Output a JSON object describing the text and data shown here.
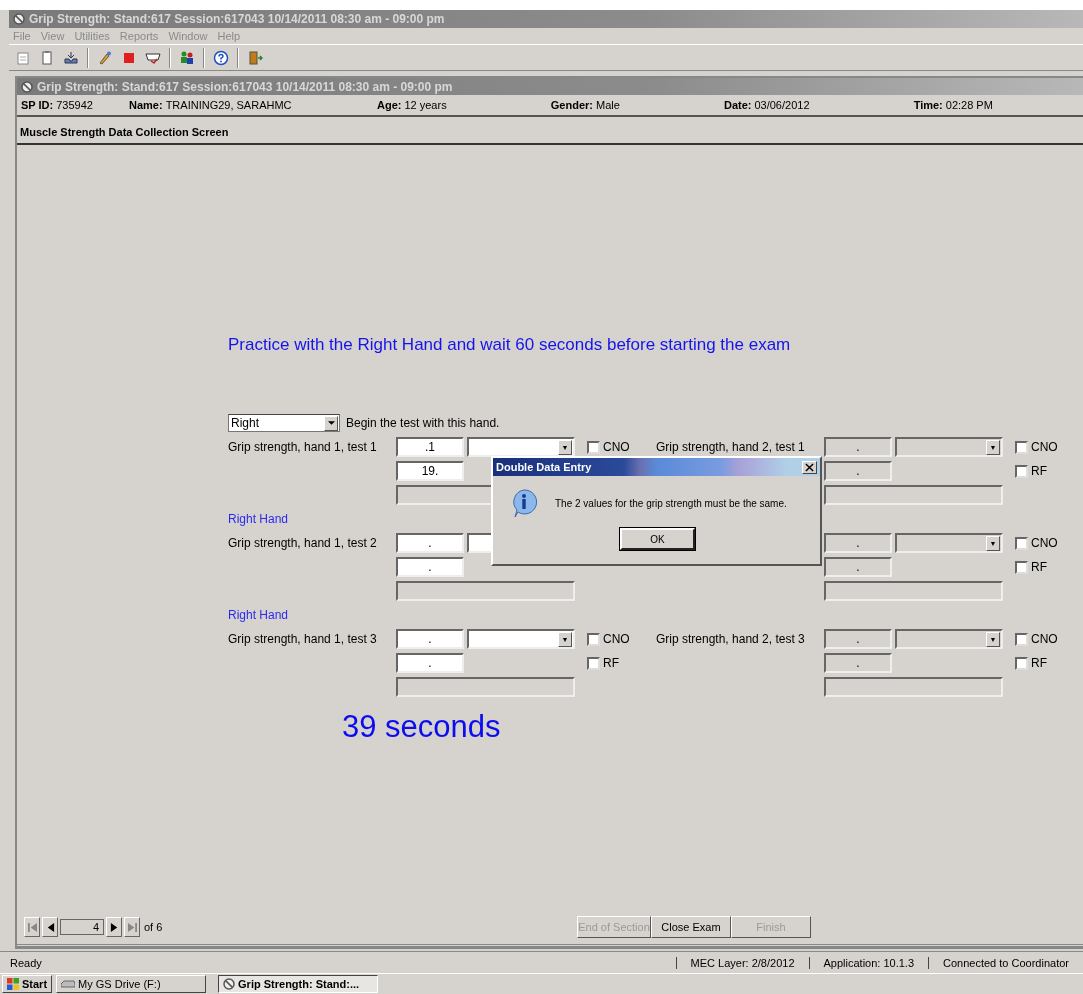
{
  "window": {
    "title": "Grip Strength: Stand:617 Session:617043 10/14/2011 08:30 am - 09:00 pm"
  },
  "menu": [
    {
      "label": "File",
      "disabled": true
    },
    {
      "label": "View",
      "disabled": true
    },
    {
      "label": "Utilities",
      "disabled": true
    },
    {
      "label": "Reports",
      "disabled": true
    },
    {
      "label": "Window",
      "disabled": true
    },
    {
      "label": "Help",
      "disabled": true
    }
  ],
  "inner_window": {
    "title": "Grip Strength: Stand:617 Session:617043 10/14/2011 08:30 am - 09:00 pm"
  },
  "participant": [
    {
      "label": "SP ID:",
      "value": "735942"
    },
    {
      "label": "Name:",
      "value": "TRAINING29, SARAHMC"
    },
    {
      "label": "Age:",
      "value": "12 years"
    },
    {
      "label": "Gender:",
      "value": "Male"
    },
    {
      "label": "Date:",
      "value": "03/06/2012"
    },
    {
      "label": "Time:",
      "value": "02:28 PM"
    }
  ],
  "section_title": "Muscle Strength Data Collection Screen",
  "instruction": "Practice with the Right Hand and wait 60 seconds before starting the exam",
  "hand_select": {
    "value": "Right",
    "label": "Begin the test with this hand."
  },
  "tests": [
    {
      "hand_1": {
        "label": "Grip strength, hand 1, test 1",
        "disabled": false,
        "value_1": ".1",
        "value_2": "19.",
        "dropdown_arrow": "▼",
        "cno": {
          "label": "CNO",
          "checked": false
        }
      },
      "hand_2": {
        "label": "Grip strength, hand 2, test 1",
        "disabled": true,
        "value_1": ".",
        "value_2": ".",
        "dropdown_arrow": "▼",
        "cno": {
          "label": "CNO",
          "checked": false
        },
        "rf": {
          "label": "RF",
          "checked": false
        }
      }
    },
    {
      "caption": "Right Hand",
      "hand_1": {
        "label": "Grip strength, hand 1, test 2",
        "disabled": false,
        "value_1": ".",
        "value_2": "."
      },
      "hand_2": {
        "disabled": true,
        "value_1": ".",
        "value_2": ".",
        "dropdown_arrow": "▼",
        "cno": {
          "label": "CNO",
          "checked": false
        },
        "rf": {
          "label": "RF",
          "checked": false
        }
      }
    },
    {
      "caption": "Right Hand",
      "hand_1": {
        "label": "Grip strength, hand 1, test 3",
        "disabled": false,
        "value_1": ".",
        "value_2": ".",
        "dropdown_arrow": "▼",
        "cno": {
          "label": "CNO",
          "checked": false
        },
        "rf": {
          "label": "RF",
          "checked": false
        }
      },
      "hand_2": {
        "label": "Grip strength, hand 2, test 3",
        "disabled": true,
        "value_1": ".",
        "value_2": ".",
        "dropdown_arrow": "▼",
        "cno": {
          "label": "CNO",
          "checked": false
        },
        "rf": {
          "label": "RF",
          "checked": false
        }
      }
    }
  ],
  "timer": "39 seconds",
  "dialog": {
    "title": "Double Data Entry",
    "message": "The 2 values for the grip strength must be the same.",
    "button": "OK"
  },
  "pager": {
    "page": "4",
    "total": "of 6"
  },
  "buttons": [
    {
      "label": "End of Section",
      "disabled": true
    },
    {
      "label": "Close Exam",
      "disabled": false
    },
    {
      "label": "Finish",
      "disabled": true
    }
  ],
  "status_bar": {
    "state": "Ready",
    "panels": [
      "MEC Layer: 2/8/2012",
      "Application: 10.1.3",
      "Connected to Coordinator"
    ]
  },
  "taskbar": {
    "start": "Start",
    "items": [
      {
        "label": "My GS Drive (F:)",
        "selected": false
      },
      {
        "label": "Grip Strength: Stand:...",
        "selected": true
      }
    ]
  }
}
